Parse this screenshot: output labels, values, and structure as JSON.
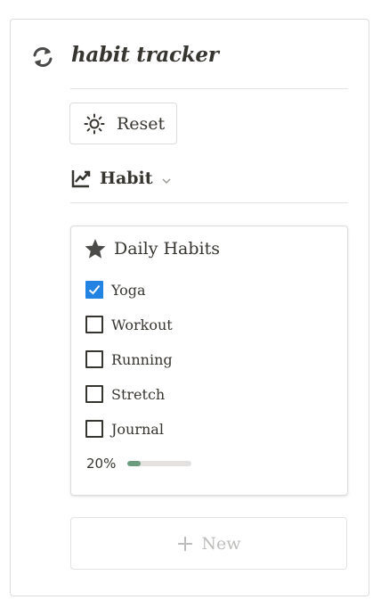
{
  "header": {
    "title": "habit tracker",
    "icon": "sync-icon"
  },
  "reset_button": {
    "label": "Reset",
    "icon": "sun-icon"
  },
  "view": {
    "label": "Habit",
    "icon": "line-chart-icon",
    "dropdown_icon": "chevron-down-icon"
  },
  "panel": {
    "title": "Daily Habits",
    "icon": "star-icon",
    "items": [
      {
        "label": "Yoga",
        "checked": true
      },
      {
        "label": "Workout",
        "checked": false
      },
      {
        "label": "Running",
        "checked": false
      },
      {
        "label": "Stretch",
        "checked": false
      },
      {
        "label": "Journal",
        "checked": false
      }
    ],
    "progress_text": "20%",
    "progress_fraction": 0.2
  },
  "new_button": {
    "label": "New",
    "icon": "plus-icon"
  },
  "colors": {
    "text": "#37352f",
    "checkbox_checked": "#2383e2",
    "progress_fill": "#6c9b7d",
    "progress_track": "#e3e2e0",
    "muted": "#bdbdbb"
  }
}
